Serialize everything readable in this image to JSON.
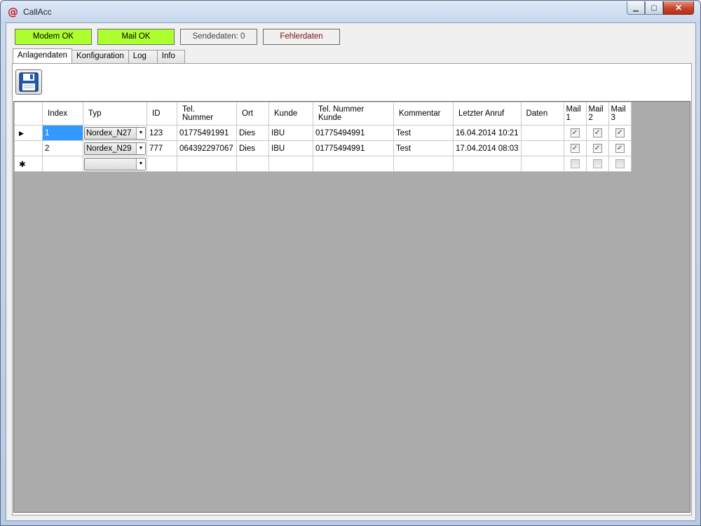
{
  "window": {
    "title": "CallAcc",
    "app_icon_glyph": "@"
  },
  "status": {
    "modem": {
      "label": "Modem OK",
      "color": "#adff2f"
    },
    "mail": {
      "label": "Mail OK",
      "color": "#adff2f"
    },
    "send": {
      "label": "Sendedaten: 0"
    },
    "errors": {
      "label": "Fehlerdaten"
    }
  },
  "tabs": [
    {
      "label": "Anlagendaten",
      "active": true
    },
    {
      "label": "Konfiguration"
    },
    {
      "label": "Log"
    },
    {
      "label": "Info"
    }
  ],
  "toolbar": {
    "save_icon": "floppy-disk-icon"
  },
  "grid": {
    "columns": {
      "index": "Index",
      "typ": "Typ",
      "id": "ID",
      "tel_1": "Tel.",
      "tel_2": "Nummer",
      "ort": "Ort",
      "kunde": "Kunde",
      "telk_1": "Tel. Nummer",
      "telk_2": "Kunde",
      "kommentar": "Kommentar",
      "letzter": "Letzter Anruf",
      "daten": "Daten",
      "mail1_1": "Mail",
      "mail1_2": "1",
      "mail2_1": "Mail",
      "mail2_2": "2",
      "mail3_1": "Mail",
      "mail3_2": "3"
    },
    "rows": [
      {
        "marker": "▶",
        "index": "1",
        "typ": "Nordex_N27",
        "id": "123",
        "tel": "01775491991",
        "ort": "Dies",
        "kunde": "IBU",
        "telk": "01775494991",
        "kommentar": "Test",
        "letzter": "16.04.2014 10:21",
        "daten": "",
        "mail1": true,
        "mail2": true,
        "mail3": true
      },
      {
        "marker": "",
        "index": "2",
        "typ": "Nordex_N29",
        "id": "777",
        "tel": "064392297067",
        "ort": "Dies",
        "kunde": "IBU",
        "telk": "01775494991",
        "kommentar": "Test",
        "letzter": "17.04.2014 08:03",
        "daten": "",
        "mail1": true,
        "mail2": true,
        "mail3": true
      }
    ],
    "new_row_marker": "✱"
  }
}
